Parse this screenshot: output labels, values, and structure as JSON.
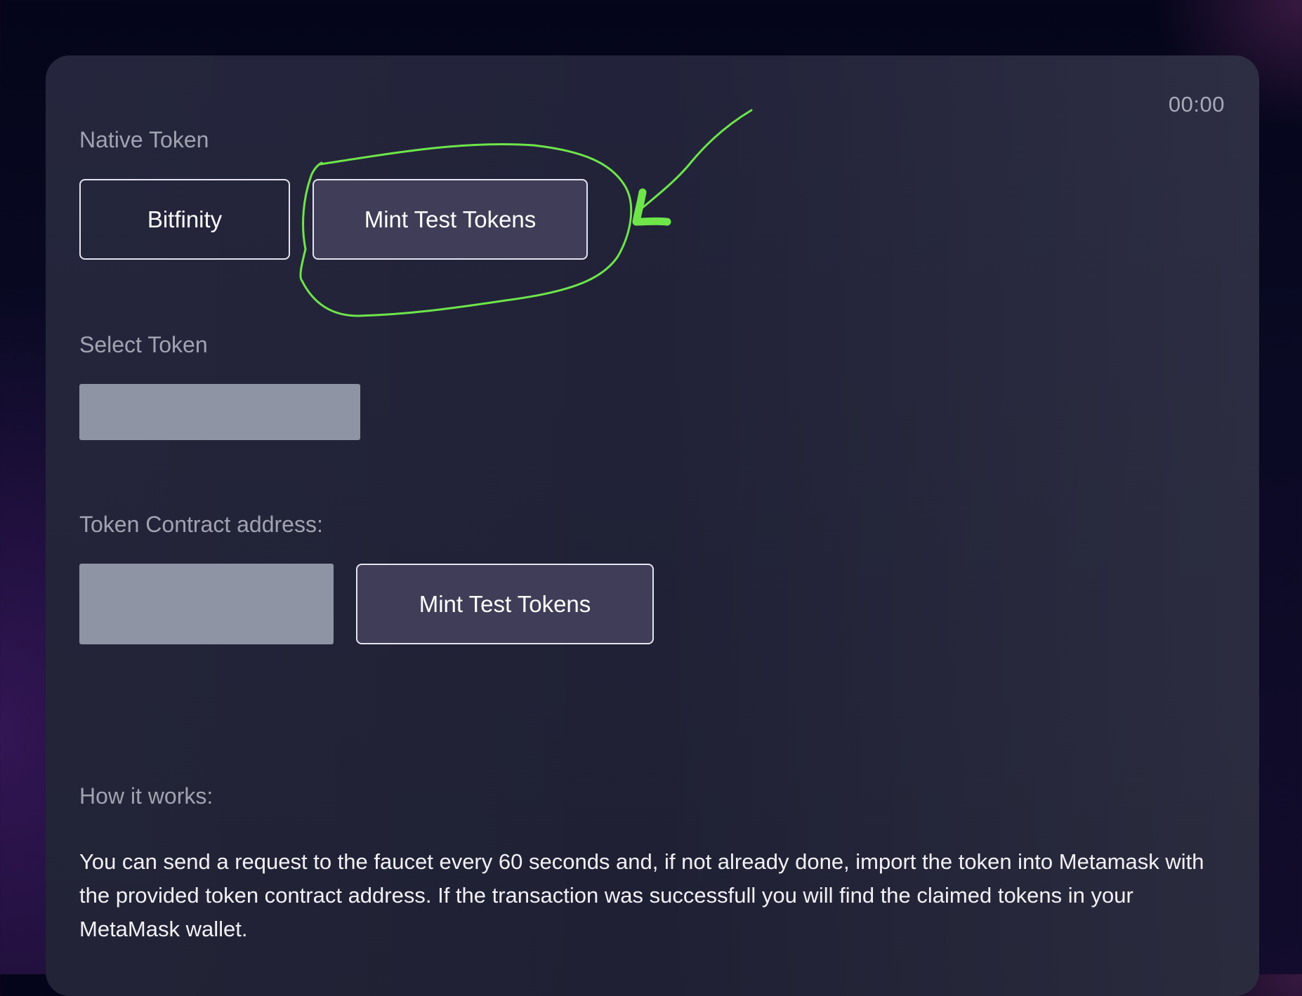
{
  "timer": "00:00",
  "native_token": {
    "label": "Native Token",
    "buttons": [
      "Bitfinity",
      "Mint Test Tokens"
    ]
  },
  "select_token": {
    "label": "Select Token"
  },
  "contract": {
    "label": "Token Contract address:",
    "mint_button": "Mint Test Tokens"
  },
  "how_it_works": {
    "label": "How it works:",
    "text": "You can send a request to the faucet every 60 seconds and, if not already done, import the token into Metamask with the provided token contract address. If the transaction was successfull you will find the claimed tokens in your MetaMask wallet."
  },
  "annotation_color": "#6ee64a"
}
